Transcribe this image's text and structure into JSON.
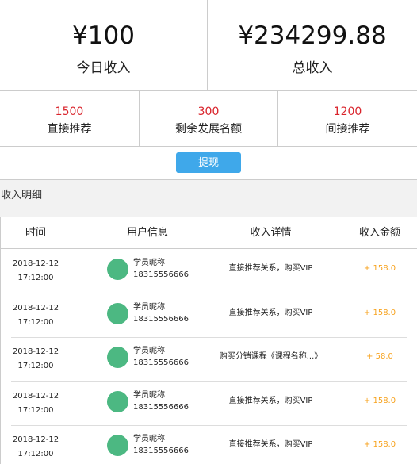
{
  "summary": {
    "today_amount": "¥100",
    "today_label": "今日收入",
    "total_amount": "¥234299.88",
    "total_label": "总收入"
  },
  "stats": [
    {
      "value": "1500",
      "label": "直接推荐"
    },
    {
      "value": "300",
      "label": "剩余发展名额"
    },
    {
      "value": "1200",
      "label": "间接推荐"
    }
  ],
  "withdraw_label": "提现",
  "section_title": "收入明细",
  "table": {
    "headers": [
      "时间",
      "用户信息",
      "收入详情",
      "收入金额"
    ],
    "rows": [
      {
        "date": "2018-12-12",
        "time": "17:12:00",
        "nickname": "学员昵称",
        "phone": "18315556666",
        "detail": "直接推荐关系，购买VIP",
        "amount": "+ 158.0"
      },
      {
        "date": "2018-12-12",
        "time": "17:12:00",
        "nickname": "学员昵称",
        "phone": "18315556666",
        "detail": "直接推荐关系，购买VIP",
        "amount": "+ 158.0"
      },
      {
        "date": "2018-12-12",
        "time": "17:12:00",
        "nickname": "学员昵称",
        "phone": "18315556666",
        "detail": "购买分销课程《课程名称...》",
        "amount": "+ 58.0"
      },
      {
        "date": "2018-12-12",
        "time": "17:12:00",
        "nickname": "学员昵称",
        "phone": "18315556666",
        "detail": "直接推荐关系，购买VIP",
        "amount": "+ 158.0"
      },
      {
        "date": "2018-12-12",
        "time": "17:12:00",
        "nickname": "学员昵称",
        "phone": "18315556666",
        "detail": "直接推荐关系，购买VIP",
        "amount": "+ 158.0"
      }
    ]
  },
  "colors": {
    "stat_value": "#d9232b",
    "button": "#3fa8ea",
    "avatar": "#4cb882",
    "amount": "#f7a21d"
  },
  "icons": {
    "avatar": "avatar-circle"
  }
}
